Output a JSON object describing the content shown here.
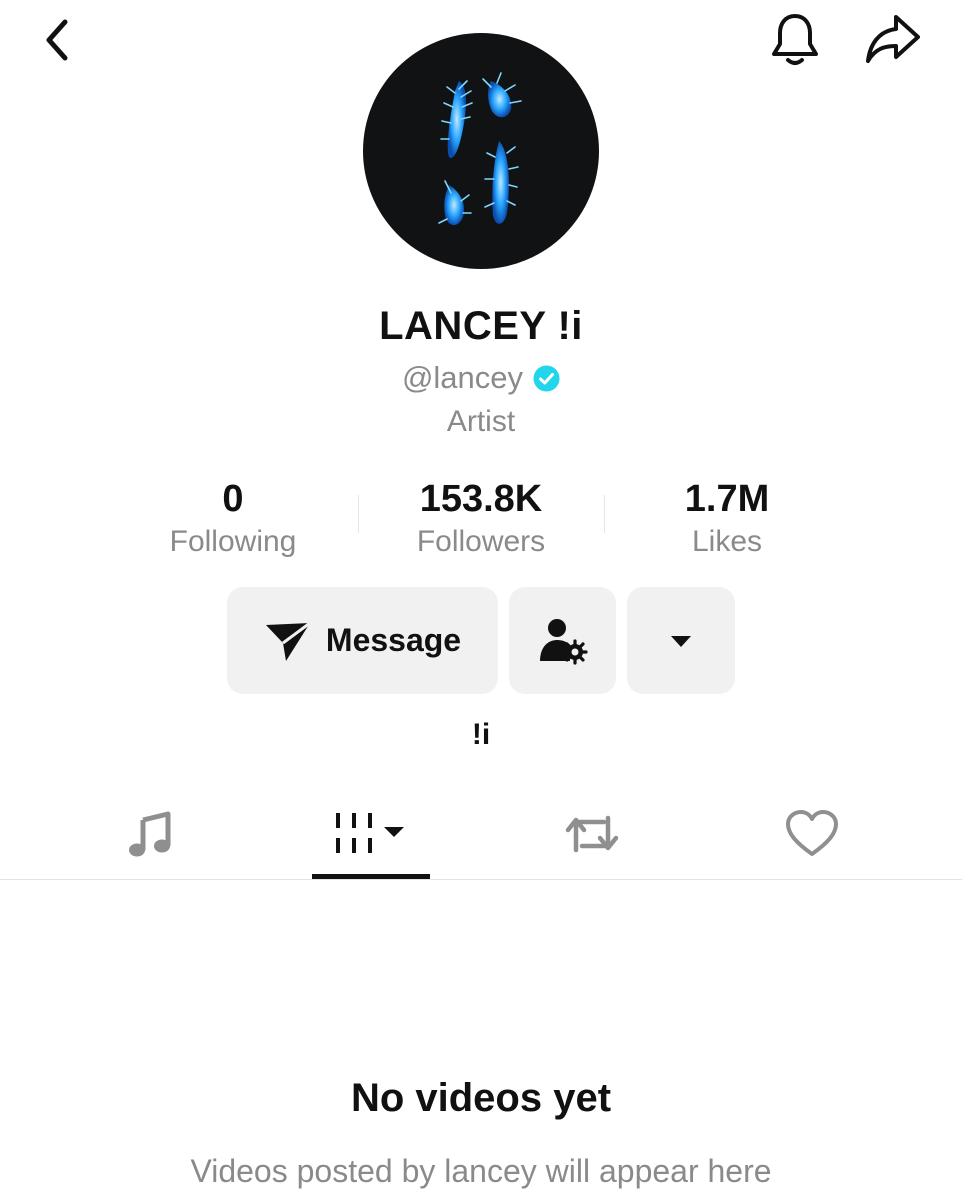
{
  "header": {
    "back_icon": "chevron-left-icon",
    "bell_icon": "bell-icon",
    "share_icon": "share-arrow-icon"
  },
  "profile": {
    "display_name": "LANCEY !i",
    "handle": "@lancey",
    "verified": true,
    "category": "Artist",
    "bio": "!i"
  },
  "stats": [
    {
      "value": "0",
      "label": "Following"
    },
    {
      "value": "153.8K",
      "label": "Followers"
    },
    {
      "value": "1.7M",
      "label": "Likes"
    }
  ],
  "actions": {
    "message_label": "Message",
    "message_icon": "send-icon",
    "add_friend_icon": "person-settings-icon",
    "more_icon": "caret-down-icon"
  },
  "tabs": [
    {
      "icon": "music-note-icon",
      "selected": false
    },
    {
      "icon": "grid-bars-icon",
      "selected": true
    },
    {
      "icon": "repost-icon",
      "selected": false
    },
    {
      "icon": "heart-icon",
      "selected": false
    }
  ],
  "empty_state": {
    "title": "No videos yet",
    "subtitle": "Videos posted by lancey will appear here"
  },
  "colors": {
    "verified_badge": "#20d5ec",
    "secondary_text": "#8a8a8a",
    "button_bg": "#f1f1f2",
    "avatar_bg": "#101214",
    "avatar_art": "#29a8ff"
  }
}
